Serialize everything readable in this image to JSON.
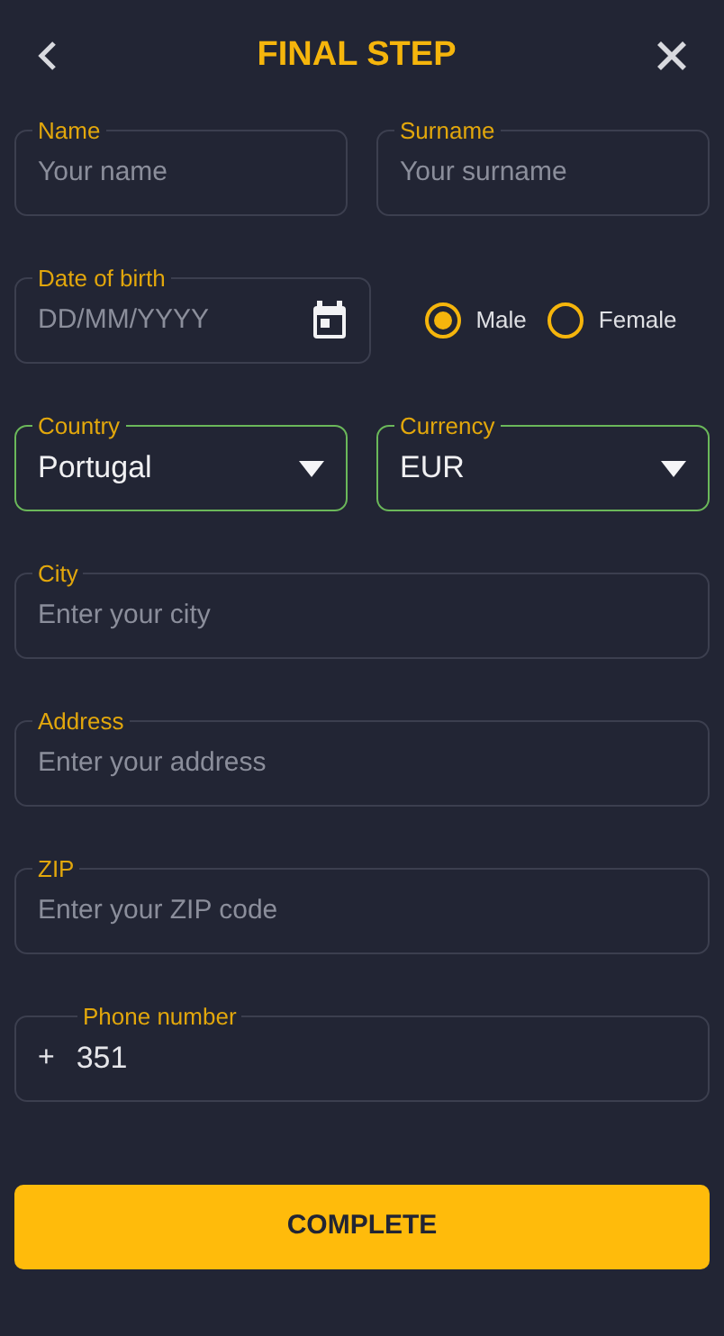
{
  "header": {
    "title": "FINAL STEP"
  },
  "rows": [
    [
      {
        "kind": "text",
        "label": "Name",
        "placeholder": "Your name",
        "valid": false
      },
      {
        "kind": "text",
        "label": "Surname",
        "placeholder": "Your surname",
        "valid": false
      }
    ],
    [
      {
        "kind": "date",
        "label": "Date of birth",
        "placeholder": "DD/MM/YYYY",
        "valid": false
      },
      {
        "kind": "radio_group",
        "options": [
          {
            "label": "Male",
            "selected": true
          },
          {
            "label": "Female",
            "selected": false
          }
        ]
      }
    ],
    [
      {
        "kind": "select",
        "label": "Country",
        "value": "Portugal",
        "valid": true
      },
      {
        "kind": "select",
        "label": "Currency",
        "value": "EUR",
        "valid": true
      }
    ],
    [
      {
        "kind": "text",
        "label": "City",
        "placeholder": "Enter your city",
        "valid": false
      }
    ],
    [
      {
        "kind": "text",
        "label": "Address",
        "placeholder": "Enter your address",
        "valid": false
      }
    ],
    [
      {
        "kind": "text",
        "label": "ZIP",
        "placeholder": "Enter your ZIP code",
        "valid": false
      }
    ],
    [
      {
        "kind": "phone",
        "label": "Phone number",
        "prefix": "+",
        "value": "351",
        "valid": false
      }
    ]
  ],
  "submit": {
    "label": "COMPLETE"
  }
}
